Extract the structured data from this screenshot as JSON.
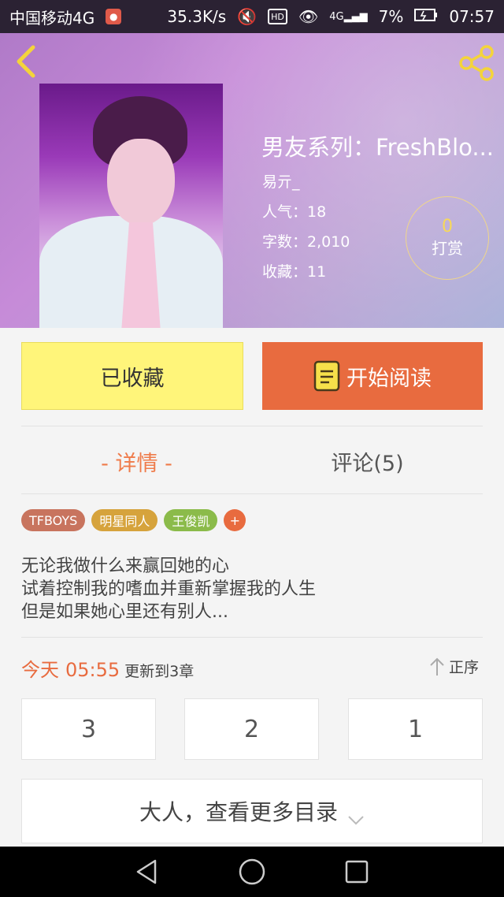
{
  "status_bar": {
    "carrier": "中国移动4G",
    "speed": "35.3K/s",
    "hd": "HD",
    "network": "4G",
    "battery": "7%",
    "time": "07:57"
  },
  "book": {
    "title": "男友系列：FreshBlo...",
    "author": "易亓_",
    "popularity": "人气：18",
    "word_count": "字数：2,010",
    "favorites": "收藏：11",
    "tip_count": "0",
    "tip_label": "打赏"
  },
  "actions": {
    "collected_label": "已收藏",
    "read_label": "开始阅读"
  },
  "tabs": {
    "detail": "- 详情 -",
    "comments": "评论(5)"
  },
  "tags": [
    {
      "label": "TFBOYS",
      "color": "#c8745e"
    },
    {
      "label": "明星同人",
      "color": "#d6a33c"
    },
    {
      "label": "王俊凯",
      "color": "#8bbb4a"
    }
  ],
  "tag_add": "+",
  "intro": [
    "无论我做什么来赢回她的心",
    "试着控制我的嗜血并重新掌握我的人生",
    "但是如果她心里还有别人..."
  ],
  "update": {
    "day": "今天",
    "time": "05:55",
    "text": "更新到3章",
    "sort_label": "正序"
  },
  "chapters": [
    "3",
    "2",
    "1"
  ],
  "more_toc_label": "大人，查看更多目录",
  "colors": {
    "accent_orange": "#e86b3f",
    "collect_yellow": "#fff57a"
  }
}
